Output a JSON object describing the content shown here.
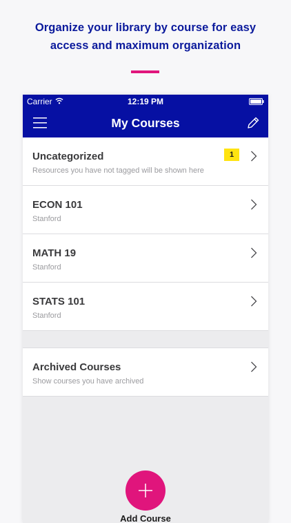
{
  "promo": {
    "headline": "Organize your library by course for easy access and maximum organization",
    "accent_color": "#e0157c",
    "text_color": "#0b1a9c"
  },
  "status_bar": {
    "carrier": "Carrier",
    "time": "12:19 PM",
    "icons": [
      "wifi-icon",
      "battery-icon"
    ]
  },
  "nav": {
    "title": "My Courses",
    "left_icon": "menu-icon",
    "right_icon": "edit-icon",
    "background": "#0610a3"
  },
  "courses": [
    {
      "title": "Uncategorized",
      "subtitle": "Resources you have not tagged will be shown here",
      "badge": "1"
    },
    {
      "title": "ECON 101",
      "subtitle": "Stanford"
    },
    {
      "title": "MATH 19",
      "subtitle": "Stanford"
    },
    {
      "title": "STATS 101",
      "subtitle": "Stanford"
    }
  ],
  "archived": {
    "title": "Archived Courses",
    "subtitle": "Show courses you have archived"
  },
  "fab": {
    "icon": "plus-icon",
    "label": "Add Course",
    "color": "#e0157c"
  }
}
